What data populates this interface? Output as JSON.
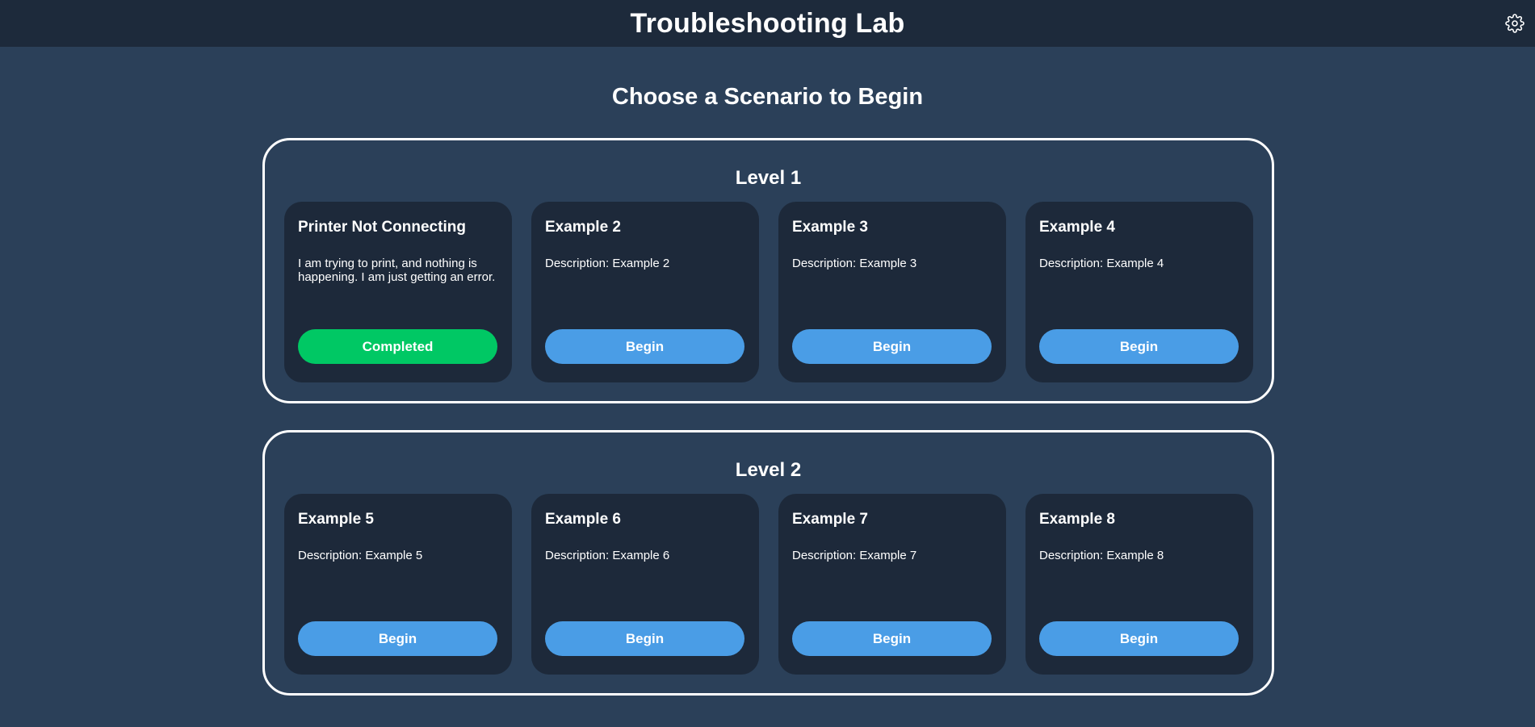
{
  "header": {
    "title": "Troubleshooting Lab",
    "settings_icon": "gear-icon"
  },
  "page": {
    "heading": "Choose a Scenario to Begin"
  },
  "colors": {
    "background": "#2b4059",
    "header": "#1d2a3b",
    "card": "#1d293a",
    "begin_button": "#4a9de6",
    "completed_button": "#00c864"
  },
  "levels": [
    {
      "title": "Level 1",
      "cards": [
        {
          "title": "Printer Not Connecting",
          "description": "I am trying to print, and nothing is happening. I am just getting an error.",
          "button": "Completed"
        },
        {
          "title": "Example 2",
          "description": "Description: Example 2",
          "button": "Begin"
        },
        {
          "title": "Example 3",
          "description": "Description: Example 3",
          "button": "Begin"
        },
        {
          "title": "Example 4",
          "description": "Description: Example 4",
          "button": "Begin"
        }
      ]
    },
    {
      "title": "Level 2",
      "cards": [
        {
          "title": "Example 5",
          "description": "Description: Example 5",
          "button": "Begin"
        },
        {
          "title": "Example 6",
          "description": "Description: Example 6",
          "button": "Begin"
        },
        {
          "title": "Example 7",
          "description": "Description: Example 7",
          "button": "Begin"
        },
        {
          "title": "Example 8",
          "description": "Description: Example 8",
          "button": "Begin"
        }
      ]
    }
  ]
}
